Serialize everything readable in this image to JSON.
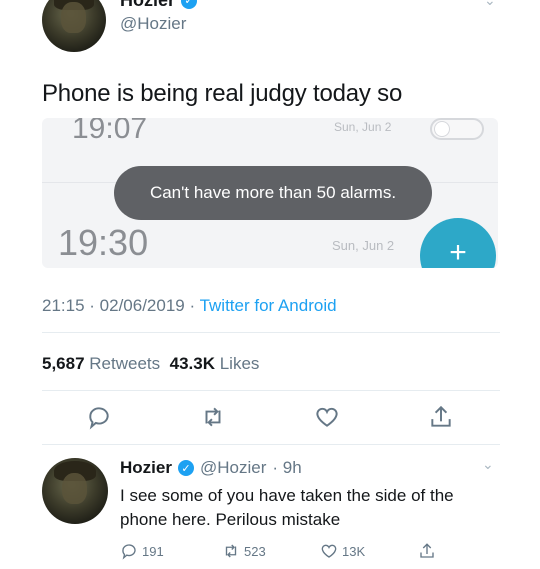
{
  "top_tweet": {
    "name": "Hozier",
    "handle": "@Hozier",
    "text": "Phone is being real judgy today so"
  },
  "embedded_screenshot": {
    "alarm_top_time": "19:07",
    "alarm_top_date": "Sun, Jun 2",
    "toast": "Can't have more than 50 alarms.",
    "alarm_time": "19:30",
    "alarm_date": "Sun, Jun 2",
    "fab_icon": "+"
  },
  "meta": {
    "time": "21:15",
    "sep1": " · ",
    "date": "02/06/2019",
    "sep2": " · ",
    "app": "Twitter for Android"
  },
  "stats": {
    "retweets": "5,687",
    "retweets_label": "Retweets",
    "likes": "43.3K",
    "likes_label": "Likes"
  },
  "actions": [
    "reply-icon",
    "retweet-icon",
    "like-icon",
    "share-icon"
  ],
  "reply": {
    "name": "Hozier",
    "handle": "@Hozier",
    "time": "· 9h",
    "text": "I see some of you have taken the side of the phone here. Perilous mistake",
    "replies": "191",
    "retweets": "523",
    "likes": "13K"
  },
  "colors": {
    "accent": "#1da1f2",
    "muted": "#657786",
    "fab": "#2da8c8",
    "toast": "#5f6165"
  }
}
